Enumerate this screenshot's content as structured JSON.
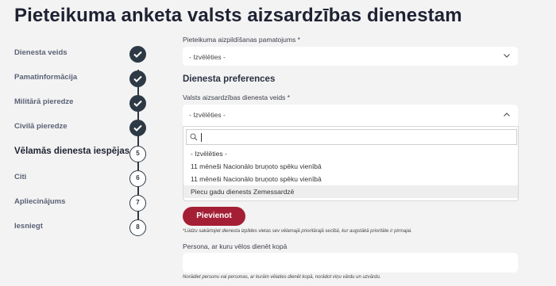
{
  "page": {
    "title": "Pieteikuma anketa valsts aizsardzības dienestam"
  },
  "steps": [
    {
      "label": "Dienesta veids",
      "status": "done"
    },
    {
      "label": "Pamatinformācija",
      "status": "done"
    },
    {
      "label": "Militārā pieredze",
      "status": "done"
    },
    {
      "label": "Civilā pieredze",
      "status": "done"
    },
    {
      "label": "Vēlamās dienesta iespējas",
      "status": "active",
      "number": "5"
    },
    {
      "label": "Citi",
      "status": "todo",
      "number": "6"
    },
    {
      "label": "Apliecinājums",
      "status": "todo",
      "number": "7"
    },
    {
      "label": "Iesniegt",
      "status": "todo",
      "number": "8"
    }
  ],
  "form": {
    "basis": {
      "label": "Pieteikuma aizpildīšanas pamatojums *",
      "value": "- Izvēlēties -"
    },
    "section_heading": "Dienesta preferences",
    "service_type": {
      "label": "Valsts aizsardzības dienesta veids *",
      "value": "- Izvēlēties -",
      "search_value": "",
      "options": [
        "- Izvēlēties -",
        "11 mēneši Nacionālo bruņoto spēku vienībā",
        "11 mēneši Nacionālo bruņoto spēku vienībā",
        "Piecu gadu dienests Zemessardzē"
      ],
      "highlighted_index": 3
    },
    "add_button": "Pievienot",
    "priority_note": "*Lūdzu sakārtojiet dienesta izpildes vietas sev vēlamajā prioritārajā secībā, kur augstākā prioritāte ir pirmajai.",
    "companion": {
      "label": "Persona, ar kuru vēlos dienēt kopā",
      "value": "",
      "note": "Norādiet personu vai personas, ar kurām vēlaties dienēt kopā, norādot viņu vārdu un uzvārdu."
    }
  },
  "colors": {
    "accent": "#a41f35",
    "step_dark": "#2d3a45",
    "background": "#f3f3f3"
  },
  "icons": {
    "done": "check-icon",
    "select": "chevron-down-icon",
    "open_select": "chevron-up-icon",
    "search": "search-icon"
  }
}
